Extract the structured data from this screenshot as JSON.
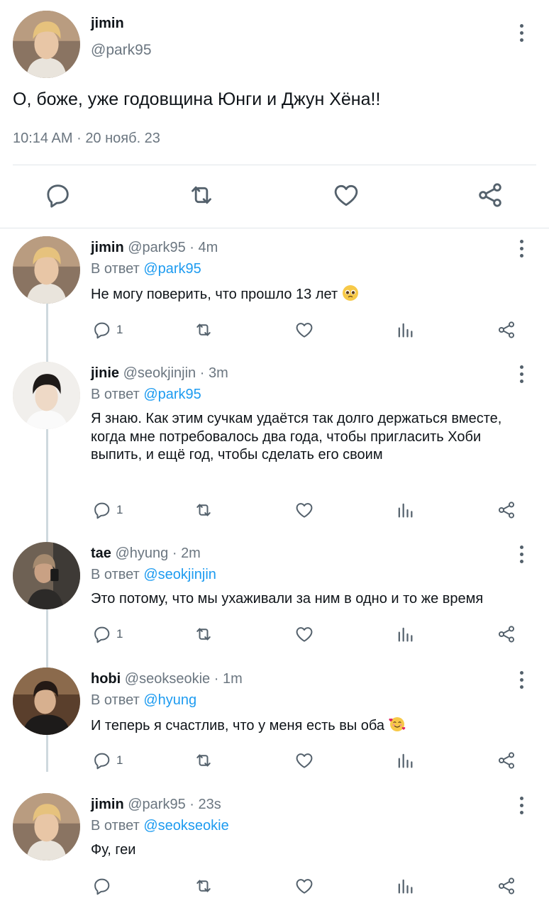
{
  "main": {
    "name": "jimin",
    "handle": "@park95",
    "text": "О, боже, уже годовщина Юнги и Джун Хёна!!",
    "time": "10:14 AM",
    "separator": "·",
    "date": "20 нояб. 23"
  },
  "replies": [
    {
      "name": "jimin",
      "handle": "@park95",
      "sep": "·",
      "time": "4m",
      "reply_prefix": "В ответ",
      "reply_to": "@park95",
      "text": "Не могу поверить, что прошло 13 лет",
      "emoji": "pleading-face",
      "reply_count": "1"
    },
    {
      "name": "jinie",
      "handle": "@seokjinjin",
      "sep": "·",
      "time": "3m",
      "reply_prefix": "В ответ",
      "reply_to": "@park95",
      "text": "Я знаю. Как этим сучкам удаётся так долго держаться вместе, когда мне потребовалось два года, чтобы пригласить Хоби выпить, и ещё год, чтобы сделать его своим",
      "reply_count": "1"
    },
    {
      "name": "tae",
      "handle": "@hyung",
      "sep": "·",
      "time": "2m",
      "reply_prefix": "В ответ",
      "reply_to": "@seokjinjin",
      "text": "Это потому, что мы ухаживали за ним в одно и то же время",
      "reply_count": "1"
    },
    {
      "name": "hobi",
      "handle": "@seokseokie",
      "sep": "·",
      "time": "1m",
      "reply_prefix": "В ответ",
      "reply_to": "@hyung",
      "text": "И теперь я счастлив, что у меня есть вы оба",
      "emoji": "smiling-face-with-hearts",
      "reply_count": "1"
    },
    {
      "name": "jimin",
      "handle": "@park95",
      "sep": "·",
      "time": "23s",
      "reply_prefix": "В ответ",
      "reply_to": "@seokseokie",
      "text": "Фу, геи",
      "reply_count": ""
    }
  ],
  "colors": {
    "mention": "#1d9bf0",
    "secondary": "#6b7680",
    "icon": "#54616c",
    "thread": "#cfd9de"
  }
}
